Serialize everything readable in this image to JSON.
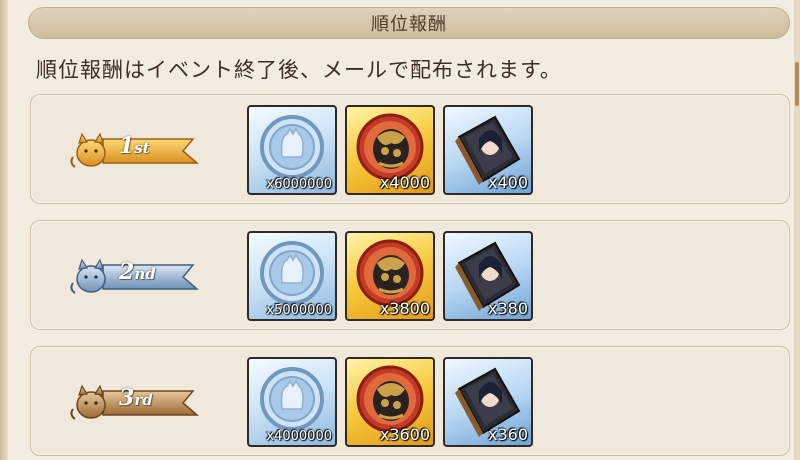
{
  "header": {
    "title": "順位報酬"
  },
  "description": "順位報酬はイベント終了後、メールで配布されます。",
  "colors": {
    "gold": "#e8a93a",
    "silver": "#8fb3d6",
    "bronze": "#b48452"
  },
  "rewards": [
    {
      "rank_num": "1",
      "rank_suffix": "st",
      "tier": "gold",
      "items": [
        {
          "icon": "silver-coin-icon",
          "qty": "x6000000"
        },
        {
          "icon": "medal-token-icon",
          "qty": "x4000"
        },
        {
          "icon": "character-book-icon",
          "qty": "x400"
        }
      ]
    },
    {
      "rank_num": "2",
      "rank_suffix": "nd",
      "tier": "silver",
      "items": [
        {
          "icon": "silver-coin-icon",
          "qty": "x5000000"
        },
        {
          "icon": "medal-token-icon",
          "qty": "x3800"
        },
        {
          "icon": "character-book-icon",
          "qty": "x380"
        }
      ]
    },
    {
      "rank_num": "3",
      "rank_suffix": "rd",
      "tier": "bronze",
      "items": [
        {
          "icon": "silver-coin-icon",
          "qty": "x4000000"
        },
        {
          "icon": "medal-token-icon",
          "qty": "x3600"
        },
        {
          "icon": "character-book-icon",
          "qty": "x360"
        }
      ]
    }
  ]
}
